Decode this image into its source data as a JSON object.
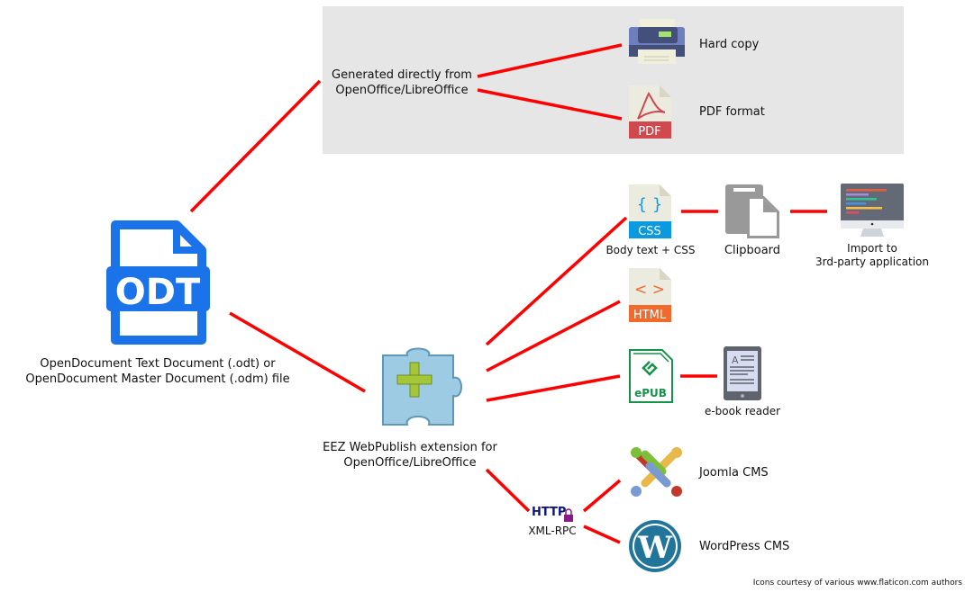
{
  "generated_group": {
    "label_line1": "Generated directly from",
    "label_line2": "OpenOffice/LibreOffice"
  },
  "outputs": {
    "hard_copy": "Hard copy",
    "pdf": "PDF format",
    "pdf_icon_text": "PDF",
    "css_caption": "Body text + CSS",
    "css_icon_text": "CSS",
    "clipboard": "Clipboard",
    "import_line1": "Import to",
    "import_line2": "3rd-party application",
    "html_icon_text": "HTML",
    "epub_icon_text": "ePUB",
    "ebook_reader": "e-book reader",
    "joomla": "Joomla CMS",
    "wordpress": "WordPress CMS"
  },
  "source": {
    "icon_text": "ODT",
    "caption_line1": "OpenDocument Text Document (.odt) or",
    "caption_line2": "OpenDocument Master Document (.odm) file"
  },
  "extension": {
    "caption_line1": "EEZ WebPublish extension for",
    "caption_line2": "OpenOffice/LibreOffice"
  },
  "protocol": {
    "icon_text": "HTTP",
    "label": "XML-RPC"
  },
  "footer": "Icons courtesy of various www.flaticon.com authors",
  "colors": {
    "connector": "#ff0000",
    "group_bg": "#e6e6e6",
    "odt_blue": "#1a73e8",
    "css_blue": "#0b99e0",
    "html_orange": "#f06a2e",
    "pdf_red": "#d0494f",
    "epub_green": "#16924a",
    "wordpress_blue": "#21759b",
    "http_navy": "#0d1582"
  }
}
